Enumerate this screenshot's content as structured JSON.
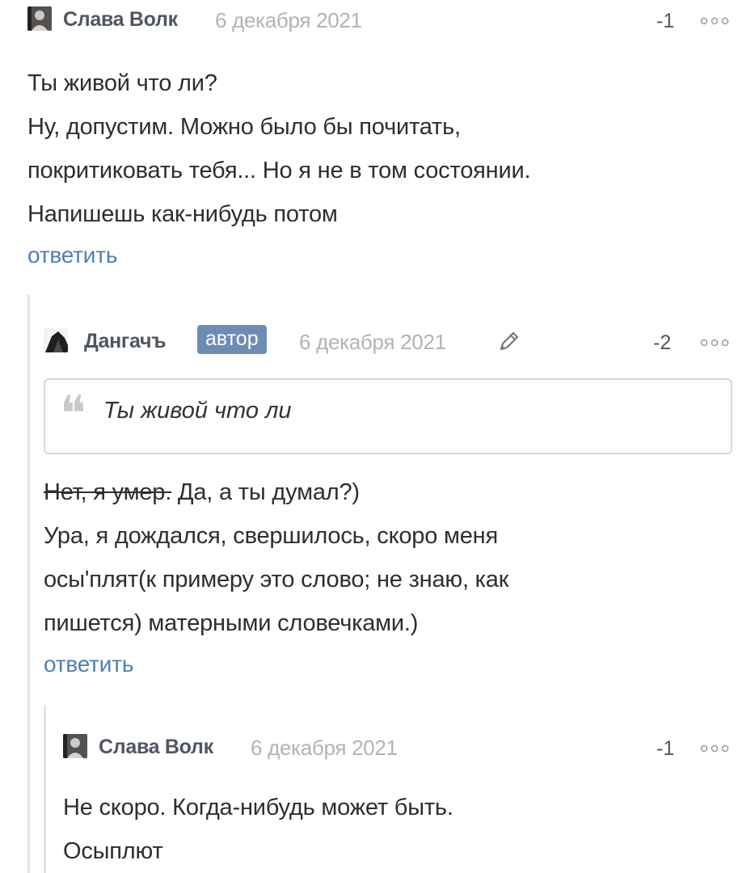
{
  "comments": [
    {
      "author": "Слава Волк",
      "date": "6 декабря 2021",
      "rating": "-1",
      "lines": [
        "Ты живой что ли?",
        "Ну, допустим. Можно было бы почитать,",
        "покритиковать тебя... Но я не в том состоянии.",
        "Напишешь как-нибудь потом"
      ],
      "reply": "ответить",
      "avatar_icon": "user-photo-avatar"
    },
    {
      "author": "Дангачъ",
      "badge": "автор",
      "date": "6 декабря 2021",
      "rating": "-2",
      "quote": "Ты живой что ли",
      "struck": "Нет, я умер.",
      "first_line_rest": " Да, а ты думал?)",
      "lines": [
        "Ура, я дождался, свершилось, скоро меня",
        "осы'плят(к примеру это слово; не знаю, как",
        "пишется) матерными словечками.)"
      ],
      "reply": "ответить",
      "avatar_icon": "user-photo-avatar",
      "edit_icon": "pencil-icon"
    },
    {
      "author": "Слава Волк",
      "date": "6 декабря 2021",
      "rating": "-1",
      "lines": [
        "Не скоро. Когда-нибудь может быть.",
        "Осыплют"
      ],
      "avatar_icon": "user-photo-avatar"
    }
  ],
  "more_icon": "more-dots-icon",
  "quote_icon": "quote-mark-icon",
  "colors": {
    "link": "#4e7fb4",
    "badge": "#6d8cb4",
    "date": "#b3b3b3",
    "author": "#4f5661"
  }
}
